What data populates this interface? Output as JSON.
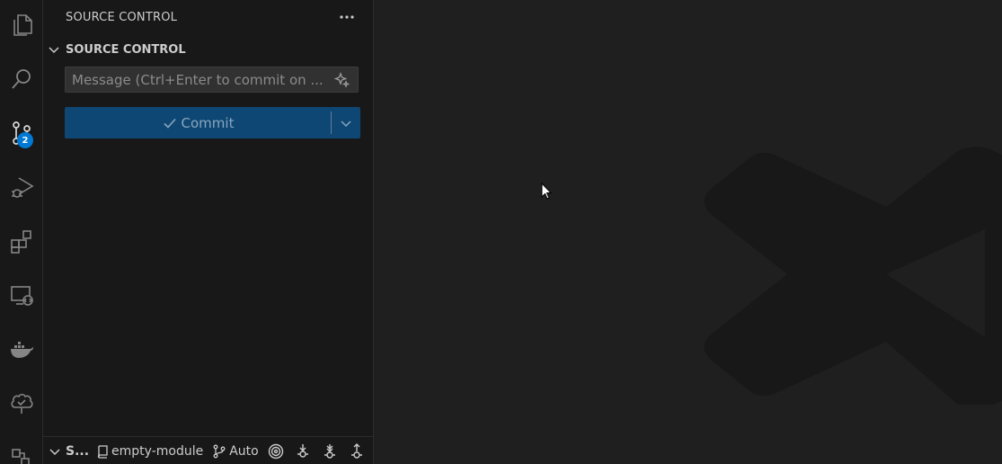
{
  "activity_bar": {
    "items": [
      {
        "icon": "files-icon",
        "label": "Explorer"
      },
      {
        "icon": "search-icon",
        "label": "Search"
      },
      {
        "icon": "source-control-icon",
        "label": "Source Control"
      },
      {
        "icon": "run-debug-icon",
        "label": "Run and Debug"
      },
      {
        "icon": "extensions-icon",
        "label": "Extensions"
      },
      {
        "icon": "remote-explorer-icon",
        "label": "Remote Explorer"
      },
      {
        "icon": "docker-icon",
        "label": "Docker"
      },
      {
        "icon": "tree-check-icon",
        "label": "Testing"
      },
      {
        "icon": "structure-icon",
        "label": "Structure"
      }
    ],
    "source_control_badge": "2"
  },
  "sidebar": {
    "title": "SOURCE CONTROL",
    "section_header": "SOURCE CONTROL",
    "message_placeholder": "Message (Ctrl+Enter to commit on ...",
    "message_value": "",
    "commit_label": "Commit"
  },
  "bottom_bar": {
    "section_label": "S...",
    "repo_name": "empty-module",
    "branch_mode": "Auto"
  },
  "colors": {
    "accent": "#0078d4",
    "commit_button": "#0e4773",
    "sidebar_bg": "#181818",
    "editor_bg": "#1f1f1f"
  }
}
